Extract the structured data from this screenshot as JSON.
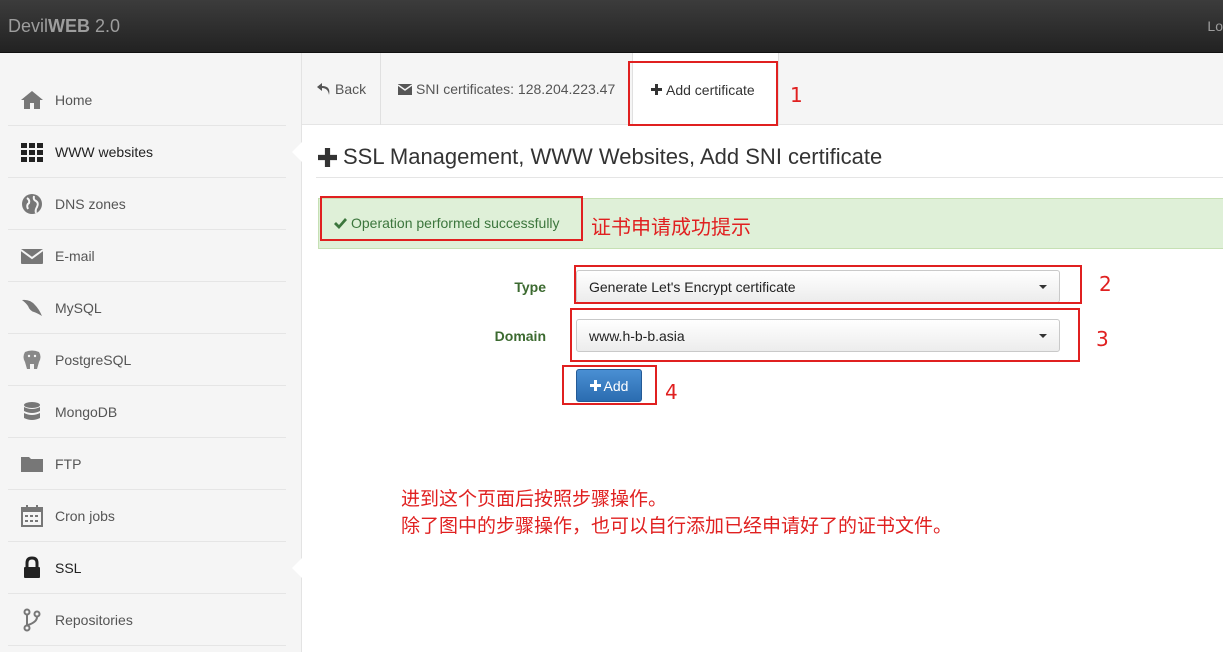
{
  "topbar": {
    "brand_light": "Devil",
    "brand_bold": "WEB",
    "brand_version": " 2.0",
    "right_text": "Lo"
  },
  "sidebar": {
    "items": [
      {
        "label": "Home",
        "icon": "home-icon"
      },
      {
        "label": "WWW websites",
        "icon": "grid-icon"
      },
      {
        "label": "DNS zones",
        "icon": "globe-icon"
      },
      {
        "label": "E-mail",
        "icon": "envelope-icon"
      },
      {
        "label": "MySQL",
        "icon": "dolphin-icon"
      },
      {
        "label": "PostgreSQL",
        "icon": "elephant-icon"
      },
      {
        "label": "MongoDB",
        "icon": "database-icon"
      },
      {
        "label": "FTP",
        "icon": "folder-icon"
      },
      {
        "label": "Cron jobs",
        "icon": "calendar-icon"
      },
      {
        "label": "SSL",
        "icon": "lock-icon"
      },
      {
        "label": "Repositories",
        "icon": "branch-icon"
      }
    ]
  },
  "tabs": {
    "back": "Back",
    "sni": "SNI certificates: 128.204.223.47",
    "add": "Add certificate"
  },
  "heading": "SSL Management, WWW Websites, Add SNI certificate",
  "alert": {
    "text": "Operation performed successfully"
  },
  "form": {
    "type_label": "Type",
    "type_value": "Generate Let's Encrypt certificate",
    "domain_label": "Domain",
    "domain_value": "www.h-b-b.asia",
    "add_button": "Add"
  },
  "annotations": {
    "step1": "1",
    "step2": "2",
    "step3": "3",
    "step4": "4",
    "success_note": "证书申请成功提示",
    "note_line1": "进到这个页面后按照步骤操作。",
    "note_line2": "除了图中的步骤操作，也可以自行添加已经申请好了的证书文件。"
  },
  "colors": {
    "annotation": "#e02020",
    "success_bg": "#dff0d8",
    "button": "#337ab7"
  }
}
